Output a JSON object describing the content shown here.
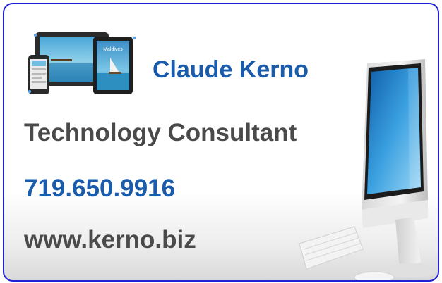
{
  "card": {
    "name": "Claude Kerno",
    "title": "Technology Consultant",
    "phone": "719.650.9916",
    "website": "www.kerno.biz"
  },
  "images": {
    "devices_label": "Maldives",
    "devices_icon": "tablet-phone-devices-icon",
    "computer_icon": "imac-computer-icon"
  },
  "colors": {
    "border": "#1f1fd6",
    "accent_blue": "#1a5cab",
    "text_gray": "#4a4a4a"
  }
}
